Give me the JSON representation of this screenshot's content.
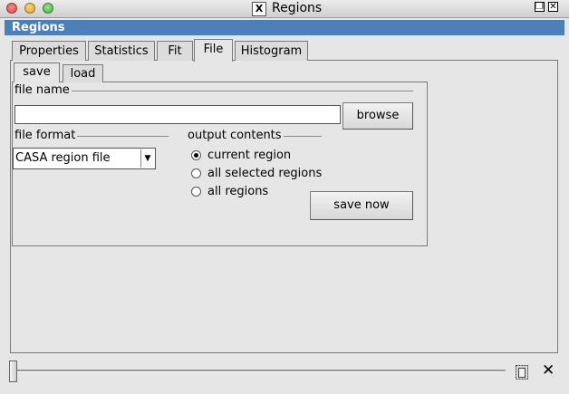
{
  "window": {
    "title": "Regions",
    "x_badge": "X"
  },
  "dock": {
    "title": "Regions",
    "float_glyph": "❐",
    "close_glyph": "✕"
  },
  "tabs": [
    {
      "label": "Properties"
    },
    {
      "label": "Statistics"
    },
    {
      "label": "Fit"
    },
    {
      "label": "File"
    },
    {
      "label": "Histogram"
    }
  ],
  "active_tab": "File",
  "subtabs": [
    {
      "label": "save"
    },
    {
      "label": "load"
    }
  ],
  "active_subtab": "save",
  "file_name": {
    "label": "file name",
    "value": "",
    "browse_label": "browse"
  },
  "file_format": {
    "label": "file format",
    "selected": "CASA region file"
  },
  "output_contents": {
    "label": "output contents",
    "options": [
      {
        "label": "current region",
        "checked": true
      },
      {
        "label": "all selected regions",
        "checked": false
      },
      {
        "label": "all regions",
        "checked": false
      }
    ]
  },
  "save_now_label": "save now",
  "slider": {
    "value": 0
  },
  "colors": {
    "dock_header": "#4b7fb8",
    "background": "#e6e6e6"
  }
}
